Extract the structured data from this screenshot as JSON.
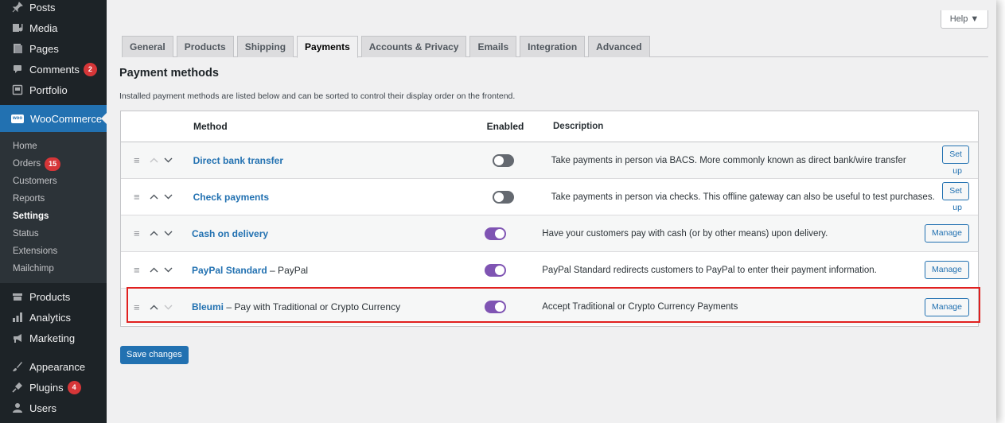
{
  "sidebar": {
    "top_items": [
      {
        "label": "Posts",
        "icon": "pin-icon"
      },
      {
        "label": "Media",
        "icon": "media-icon"
      },
      {
        "label": "Pages",
        "icon": "pages-icon"
      },
      {
        "label": "Comments",
        "icon": "comments-icon",
        "badge": "2"
      },
      {
        "label": "Portfolio",
        "icon": "portfolio-icon"
      }
    ],
    "current": {
      "label": "WooCommerce",
      "icon": "woo-icon",
      "logo_text": "woo"
    },
    "submenu": [
      "Home",
      "Orders",
      "Customers",
      "Reports",
      "Settings",
      "Status",
      "Extensions",
      "Mailchimp"
    ],
    "orders_badge": "15",
    "active_submenu": "Settings",
    "bottom_items": [
      {
        "label": "Products",
        "icon": "products-icon"
      },
      {
        "label": "Analytics",
        "icon": "analytics-icon"
      },
      {
        "label": "Marketing",
        "icon": "marketing-icon"
      },
      {
        "label": "Appearance",
        "icon": "appearance-icon"
      },
      {
        "label": "Plugins",
        "icon": "plugins-icon",
        "badge": "4"
      },
      {
        "label": "Users",
        "icon": "users-icon"
      }
    ]
  },
  "help": {
    "label": "Help ▼"
  },
  "tabs": [
    "General",
    "Products",
    "Shipping",
    "Payments",
    "Accounts & Privacy",
    "Emails",
    "Integration",
    "Advanced"
  ],
  "active_tab": "Payments",
  "page": {
    "title": "Payment methods",
    "intro": "Installed payment methods are listed below and can be sorted to control their display order on the frontend."
  },
  "table": {
    "headers": {
      "method": "Method",
      "enabled": "Enabled",
      "description": "Description"
    },
    "rows": [
      {
        "name": "Direct bank transfer",
        "suffix": "",
        "enabled": false,
        "description": "Take payments in person via BACS. More commonly known as direct bank/wire transfer",
        "action": "Set up"
      },
      {
        "name": "Check payments",
        "suffix": "",
        "enabled": false,
        "description": "Take payments in person via checks. This offline gateway can also be useful to test purchases.",
        "action": "Set up"
      },
      {
        "name": "Cash on delivery",
        "suffix": "",
        "enabled": true,
        "description": "Have your customers pay with cash (or by other means) upon delivery.",
        "action": "Manage"
      },
      {
        "name": "PayPal Standard",
        "suffix": " – PayPal",
        "enabled": true,
        "description": "PayPal Standard redirects customers to PayPal to enter their payment information.",
        "action": "Manage"
      },
      {
        "name": "Bleumi",
        "suffix": " – Pay with Traditional or Crypto Currency",
        "enabled": true,
        "description": "Accept Traditional or Crypto Currency Payments",
        "action": "Manage"
      }
    ]
  },
  "save_button": "Save changes",
  "colors": {
    "sidebar_bg": "#1d2327",
    "accent": "#2271b1",
    "toggle_on": "#7f54b3",
    "highlight": "#e1201f",
    "badge": "#d63638"
  }
}
